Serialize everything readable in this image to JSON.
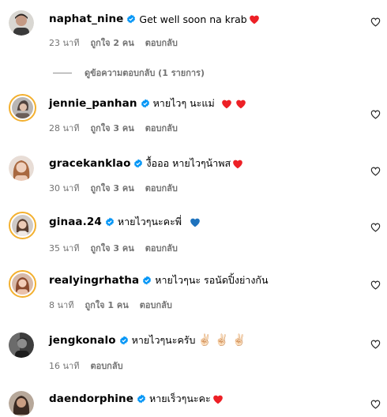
{
  "comments": [
    {
      "username": "naphat_nine",
      "text": "Get well soon na krab",
      "time": "23 นาที",
      "likes": "ถูกใจ 2 คน",
      "reply": "ตอบกลับ",
      "heart": "red",
      "ring": false
    },
    {
      "username": "jennie_panhan",
      "text": "หายไวๆ นะแม่",
      "time": "28 นาที",
      "likes": "ถูกใจ 3 คน",
      "reply": "ตอบกลับ",
      "heart": "red2",
      "ring": true
    },
    {
      "username": "gracekanklao",
      "text": "งื้อออ หายไวๆน้าพส",
      "time": "30 นาที",
      "likes": "ถูกใจ 3 คน",
      "reply": "ตอบกลับ",
      "heart": "red",
      "ring": false
    },
    {
      "username": "ginaa.24",
      "text": "หายไวๆนะคะพี่",
      "time": "35 นาที",
      "likes": "ถูกใจ 3 คน",
      "reply": "ตอบกลับ",
      "heart": "blue",
      "ring": true
    },
    {
      "username": "realyingrhatha",
      "text": "หายไวๆนะ รอนัดปิ้งย่างกัน",
      "time": "8 นาที",
      "likes": "ถูกใจ 1 คน",
      "reply": "ตอบกลับ",
      "heart": "none",
      "ring": true
    },
    {
      "username": "jengkonalo",
      "text": "หายไวๆนะครับ",
      "time": "16 นาที",
      "likes": "",
      "reply": "ตอบกลับ",
      "heart": "hands",
      "ring": false
    },
    {
      "username": "daendorphine",
      "text": "หายเร็วๆนะคะ",
      "time": "",
      "likes": "",
      "reply": "",
      "heart": "red",
      "ring": false
    }
  ],
  "replies_toggle": "ดูข้อความตอบกลับ (1 รายการ)",
  "emoji_hands": "✌🏻 ✌🏻 ✌🏻",
  "colors": {
    "verified": "#0095f6",
    "heart_red": "#ed2026",
    "heart_blue": "#1e73be",
    "meta": "#737373"
  }
}
